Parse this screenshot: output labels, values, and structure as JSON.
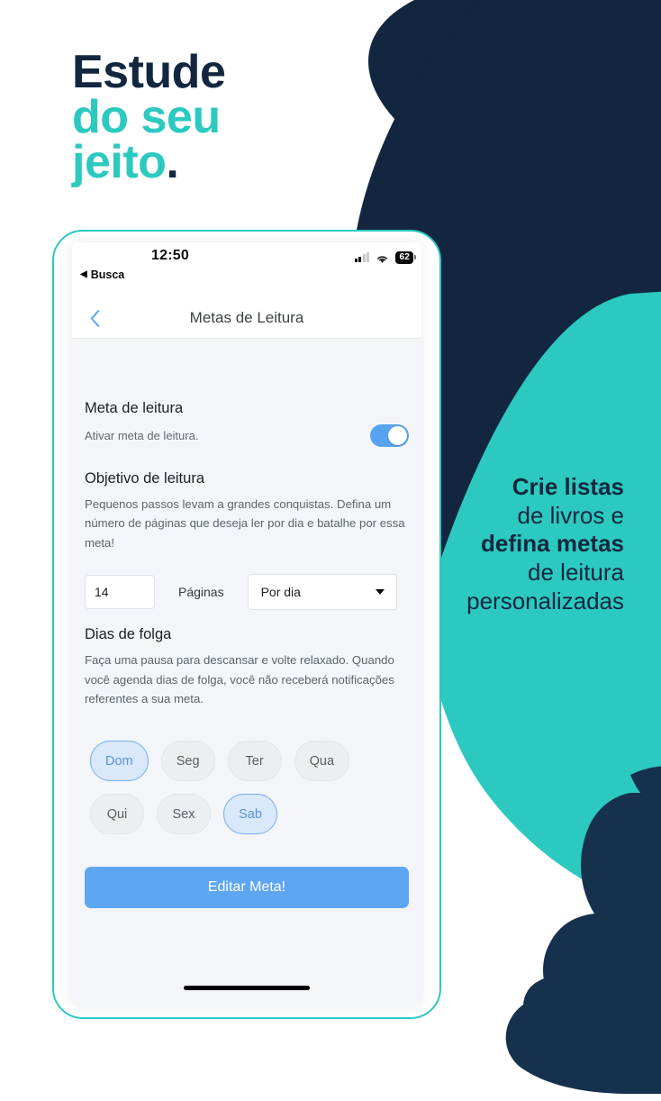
{
  "marketing": {
    "headline": {
      "line1": "Estude",
      "line2": "do seu",
      "line3": "jeito",
      "period": "."
    },
    "promo_lines": [
      "Crie listas",
      "de livros e",
      "defina metas",
      "de leitura",
      "personalizadas"
    ]
  },
  "colors": {
    "navy": "#12273f",
    "teal": "#2cc9c0",
    "blue": "#5ea6f2",
    "chip_selected_bg": "#d9e8fa",
    "chip_bg": "#eceef0",
    "screen_bg": "#f3f5f9"
  },
  "phone": {
    "status_bar": {
      "time": "12:50",
      "back_app": "Busca",
      "battery_percent": "62",
      "signal_icon": "signal-bars-icon",
      "wifi_icon": "wifi-icon",
      "battery_icon": "battery-icon"
    },
    "nav": {
      "back_icon": "chevron-left-icon",
      "title": "Metas de Leitura"
    },
    "sections": {
      "goal_toggle": {
        "title": "Meta de leitura",
        "subtitle": "Ativar meta de leitura.",
        "toggle_state": "on"
      },
      "objective": {
        "title": "Objetivo de leitura",
        "description": "Pequenos passos levam a grandes conquistas. Defina um número de páginas que deseja ler por dia e batalhe por essa meta!",
        "pages_value": "14",
        "pages_placeholder": "14",
        "pages_label": "Páginas",
        "frequency_value": "Por dia",
        "caret_icon": "chevron-down-icon"
      },
      "days_off": {
        "title": "Dias de folga",
        "description": "Faça uma pausa para descansar e volte relaxado. Quando você agenda dias de folga, você não receberá notificações referentes a sua meta.",
        "days": [
          {
            "label": "Dom",
            "selected": true
          },
          {
            "label": "Seg",
            "selected": false
          },
          {
            "label": "Ter",
            "selected": false
          },
          {
            "label": "Qua",
            "selected": false
          },
          {
            "label": "Qui",
            "selected": false
          },
          {
            "label": "Sex",
            "selected": false
          },
          {
            "label": "Sab",
            "selected": true
          }
        ]
      },
      "cta_label": "Editar Meta!"
    }
  }
}
